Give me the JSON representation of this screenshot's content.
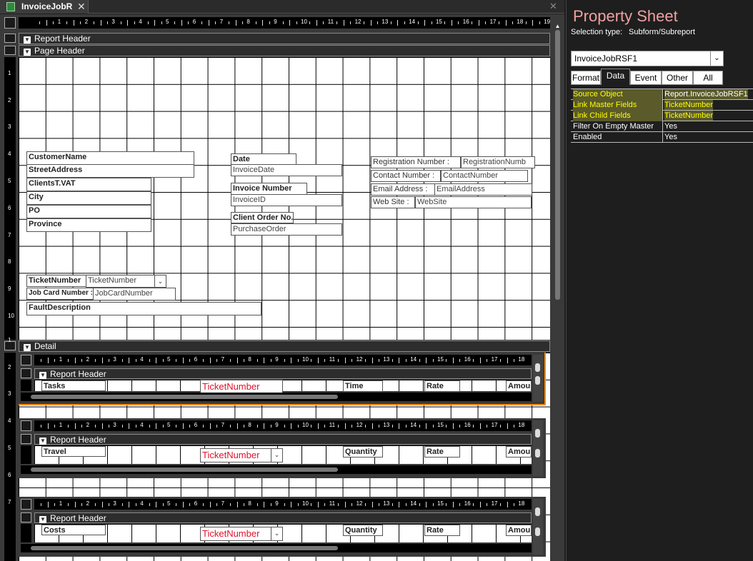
{
  "tab": {
    "title": "InvoiceJobR"
  },
  "design": {
    "ruler_ticks": [
      "1",
      "2",
      "3",
      "4",
      "5",
      "6",
      "7",
      "8",
      "9",
      "10",
      "11",
      "12",
      "13",
      "14",
      "15",
      "16",
      "17",
      "18",
      "19"
    ],
    "vruler_ticks": [
      "1",
      "2",
      "3",
      "4",
      "5",
      "6",
      "7",
      "8",
      "9",
      "10"
    ],
    "sections": {
      "report_header": "Report Header",
      "page_header": "Page Header",
      "detail": "Detail"
    },
    "fields": {
      "customer_name": "CustomerName",
      "street_address": "StreetAddress",
      "clients_vat": "ClientsT.VAT",
      "city": "City",
      "po": "PO",
      "province": "Province",
      "date_label": "Date",
      "invoice_date": "InvoiceDate",
      "invoice_number_label": "Invoice Number",
      "invoice_id": "InvoiceID",
      "client_order_label": "Client Order No.",
      "purchase_order": "PurchaseOrder",
      "registration_label": "Registration Number :",
      "registration_value": "RegistrationNumb",
      "contact_label": "Contact Number :",
      "contact_value": "ContactNumber",
      "email_label": "Email Address :",
      "email_value": "EmailAddress",
      "website_label": "Web Site :",
      "website_value": "WebSite",
      "ticket_label": "TicketNumber",
      "ticket_combo": "TicketNumber",
      "jobcard_label": "Job Card Number :",
      "jobcard_value": "JobCardNumber",
      "fault_description": "FaultDescription"
    },
    "subreports": [
      {
        "band": "Report Header",
        "first_label": "Tasks",
        "ticket": "TicketNumber",
        "col3": "Time",
        "col4": "Rate",
        "col5": "Amou"
      },
      {
        "band": "Report Header",
        "first_label": "Travel",
        "ticket": "TicketNumber",
        "col3": "Quantity",
        "col4": "Rate",
        "col5": "Amou"
      },
      {
        "band": "Report Header",
        "first_label": "Costs",
        "ticket": "TicketNumber",
        "col3": "Quantity",
        "col4": "Rate",
        "col5": "Amou"
      }
    ]
  },
  "property_sheet": {
    "title": "Property Sheet",
    "selection_type_label": "Selection type:",
    "selection_type_value": "Subform/Subreport",
    "object_selector": "InvoiceJobRSF1",
    "tabs": [
      "Format",
      "Data",
      "Event",
      "Other",
      "All"
    ],
    "active_tab": "Data",
    "rows": [
      {
        "key": "Source Object",
        "value": "Report.InvoiceJobRSF1"
      },
      {
        "key": "Link Master Fields",
        "value": "TicketNumber"
      },
      {
        "key": "Link Child Fields",
        "value": "TicketNumber"
      },
      {
        "key": "Filter On Empty Master",
        "value": "Yes"
      },
      {
        "key": "Enabled",
        "value": "Yes"
      }
    ],
    "colors": {
      "title": "#f0a0a0",
      "highlight": "#ffff00",
      "accent": "#ff8c00"
    }
  }
}
